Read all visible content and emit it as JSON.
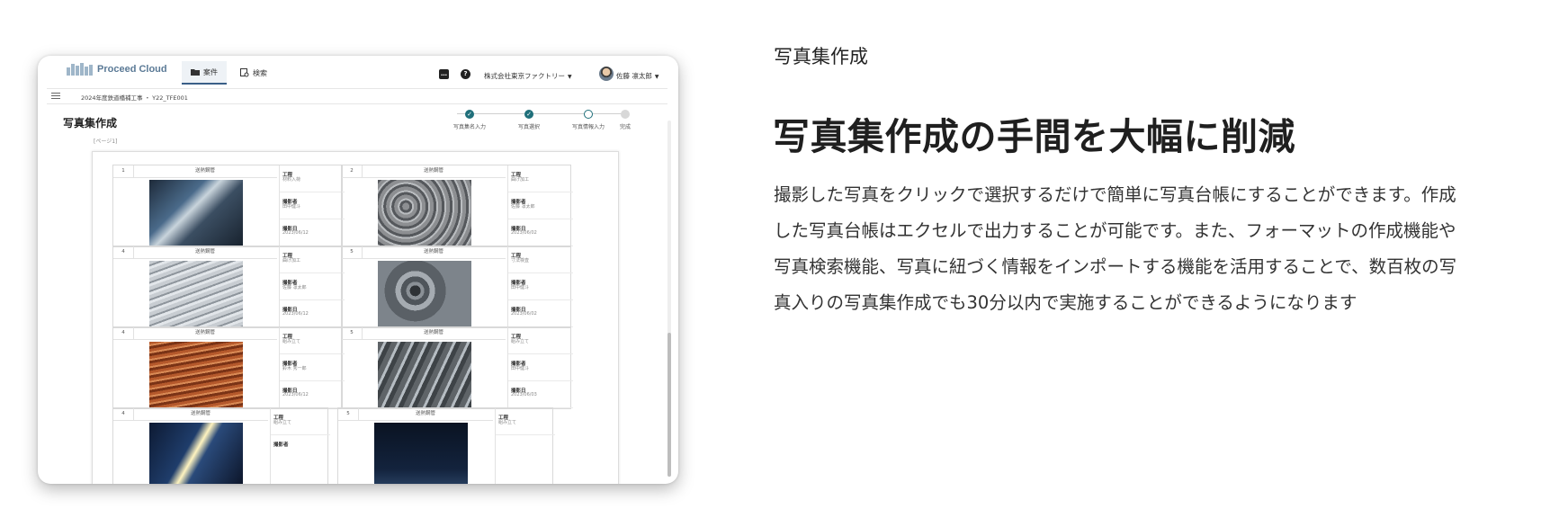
{
  "app": {
    "logo_text": "Proceed Cloud",
    "nav": [
      {
        "label": "案件",
        "icon": "folder-icon",
        "active": true
      },
      {
        "label": "検索",
        "icon": "image-search-icon",
        "active": false
      }
    ],
    "header_icons": [
      "chat-icon",
      "help-icon"
    ],
    "company": "株式会社東京ファクトリー",
    "user": "佐藤 凛太郎",
    "breadcrumb": "2024年度鉄道橋補工事 ・ Y22_TFE001",
    "page_title": "写真集作成",
    "page_label": "[ページ1]",
    "accent_color": "#1f6f7a",
    "steps": [
      {
        "label": "写真集名入力",
        "state": "done"
      },
      {
        "label": "写真選択",
        "state": "done"
      },
      {
        "label": "写真情報入力",
        "state": "current"
      },
      {
        "label": "完成",
        "state": "todo"
      }
    ],
    "cards": [
      {
        "num": "1",
        "caption": "送熱鋼管",
        "f1": "工程",
        "v1": "材料入荷",
        "f2": "撮影者",
        "v2": "田中健斗",
        "f3": "撮影日",
        "v3": "2023/06/12",
        "photo": "steel-worker"
      },
      {
        "num": "2",
        "caption": "送熱鋼管",
        "f1": "工程",
        "v1": "曲げ加工",
        "f2": "撮影者",
        "v2": "佐藤 凛太郎",
        "f3": "撮影日",
        "v3": "2023/06/02",
        "photo": "steel-coils"
      },
      {
        "num": "4",
        "caption": "送熱鋼管",
        "f1": "工程",
        "v1": "曲げ加工",
        "f2": "撮影者",
        "v2": "佐藤 凛太郎",
        "f3": "撮影日",
        "v3": "2023/06/12",
        "photo": "pipes"
      },
      {
        "num": "5",
        "caption": "送熱鋼管",
        "f1": "工程",
        "v1": "寸法検査",
        "f2": "撮影者",
        "v2": "田中健斗",
        "f3": "撮影日",
        "v3": "2023/06/02",
        "photo": "steel-rolls"
      },
      {
        "num": "4",
        "caption": "送熱鋼管",
        "f1": "工程",
        "v1": "組み立て",
        "f2": "撮影者",
        "v2": "鈴木 秀一郎",
        "f3": "撮影日",
        "v3": "2023/06/12",
        "photo": "copper"
      },
      {
        "num": "5",
        "caption": "送熱鋼管",
        "f1": "工程",
        "v1": "組み立て",
        "f2": "撮影者",
        "v2": "田中健斗",
        "f3": "撮影日",
        "v3": "2023/06/03",
        "photo": "angles"
      },
      {
        "num": "4",
        "caption": "送熱鋼管",
        "f1": "工程",
        "v1": "組み立て",
        "f2": "撮影者",
        "v2": "",
        "f3": "",
        "v3": "",
        "photo": "welding"
      },
      {
        "num": "5",
        "caption": "送熱鋼管",
        "f1": "工程",
        "v1": "組み立て",
        "f2": "",
        "v2": "",
        "f3": "",
        "v3": "",
        "photo": "night"
      }
    ]
  },
  "section_label": "写真集作成",
  "heading": "写真集作成の手間を大幅に削減",
  "body_lines": [
    "撮影した写真をクリックで選択するだけで簡単に写真台帳にすることができます。作成",
    "した写真台帳はエクセルで出力することが可能です。また、フォーマットの作成機能や",
    "写真検索機能、写真に紐づく情報をインポートする機能を活用することで、数百枚の写",
    "真入りの写真集作成でも30分以内で実施することができるようになります"
  ]
}
